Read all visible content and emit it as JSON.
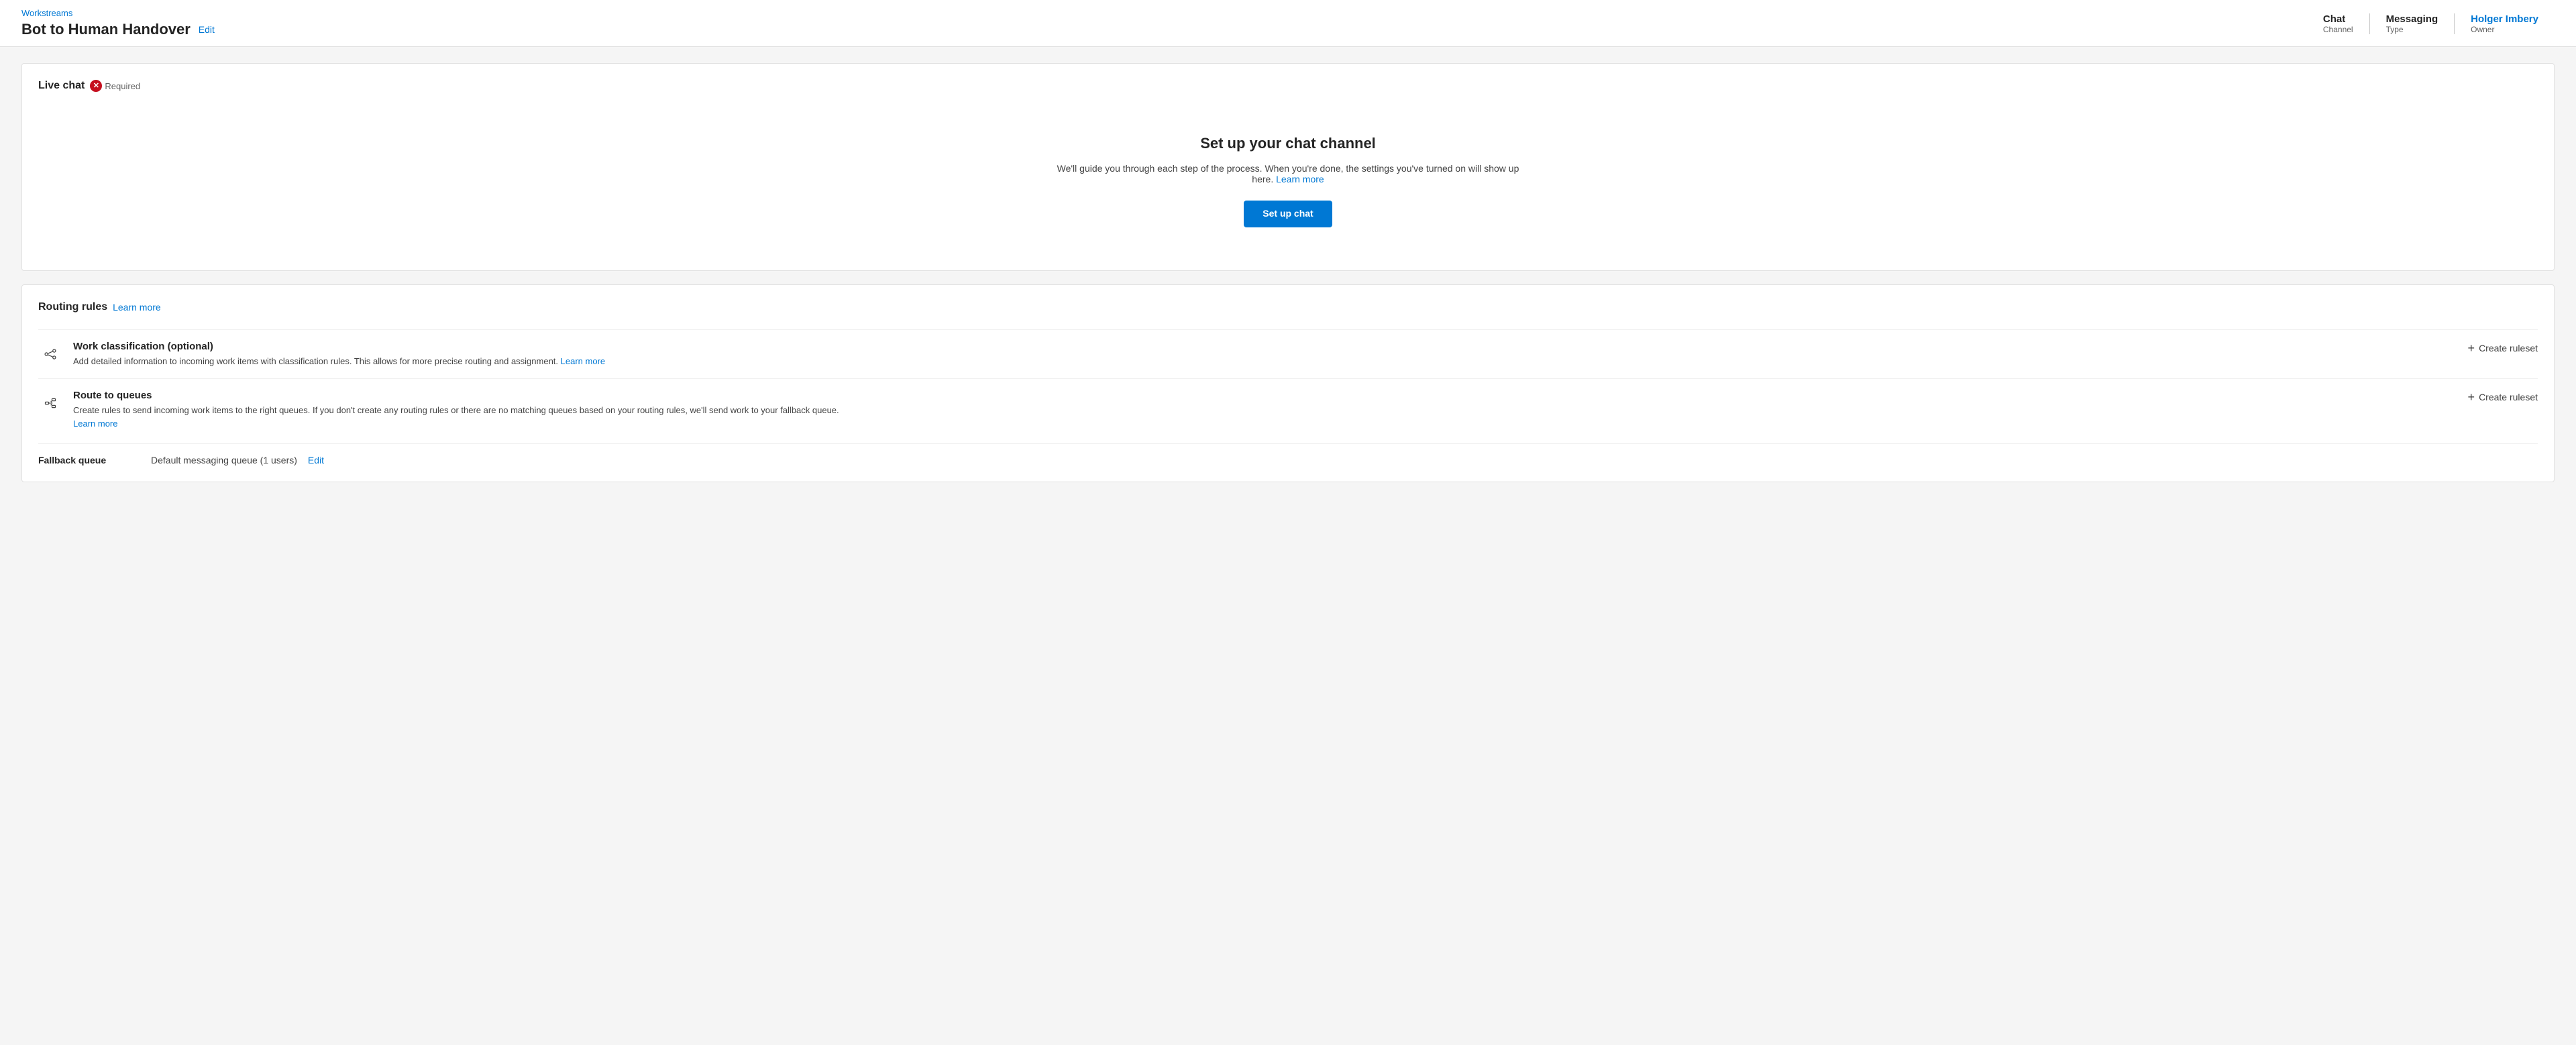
{
  "header": {
    "breadcrumb": "Workstreams",
    "title": "Bot to Human Handover",
    "edit_label": "Edit",
    "meta": [
      {
        "value": "Chat",
        "label": "Channel"
      },
      {
        "value": "Messaging",
        "label": "Type"
      },
      {
        "value": "Holger Imbery",
        "label": "Owner",
        "is_link": true
      }
    ]
  },
  "live_chat_section": {
    "label": "Live chat",
    "required_text": "Required",
    "setup_title": "Set up your chat channel",
    "setup_description": "We'll guide you through each step of the process. When you're done, the settings you've turned on will show up here.",
    "learn_more_label": "Learn more",
    "setup_button_label": "Set up chat"
  },
  "routing_section": {
    "title": "Routing rules",
    "learn_more_label": "Learn more",
    "items": [
      {
        "id": "work-classification",
        "title": "Work classification (optional)",
        "description": "Add detailed information to incoming work items with classification rules. This allows for more precise routing and assignment.",
        "learn_more_label": "Learn more",
        "action_label": "Create ruleset",
        "icon": "share-icon"
      },
      {
        "id": "route-to-queues",
        "title": "Route to queues",
        "description": "Create rules to send incoming work items to the right queues. If you don't create any routing rules or there are no matching queues based on your routing rules, we'll send work to your fallback queue.",
        "learn_more_label": "Learn more",
        "action_label": "Create ruleset",
        "icon": "route-icon"
      }
    ],
    "fallback": {
      "label": "Fallback queue",
      "value": "Default messaging queue (1 users)",
      "edit_label": "Edit"
    }
  }
}
